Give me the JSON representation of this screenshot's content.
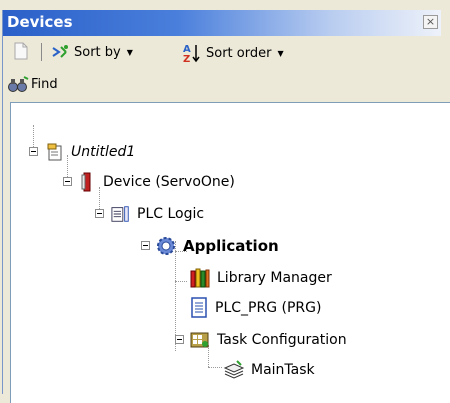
{
  "panel": {
    "title": "Devices",
    "close_glyph": "×"
  },
  "toolbar": {
    "sort_by_label": "Sort by",
    "sort_order_label": "Sort order",
    "find_label": "Find",
    "dropdown_glyph": "▼"
  },
  "tree": {
    "project": "Untitled1",
    "device": "Device (ServoOne)",
    "plc_logic": "PLC Logic",
    "application": "Application",
    "library_manager": "Library Manager",
    "plc_prg": "PLC_PRG (PRG)",
    "task_configuration": "Task Configuration",
    "main_task": "MainTask"
  },
  "colors": {
    "title_bar_start": "#2a60c8",
    "title_bar_end": "#eef2fa",
    "tree_background": "#ffffff",
    "window_background": "#ece9d8"
  }
}
